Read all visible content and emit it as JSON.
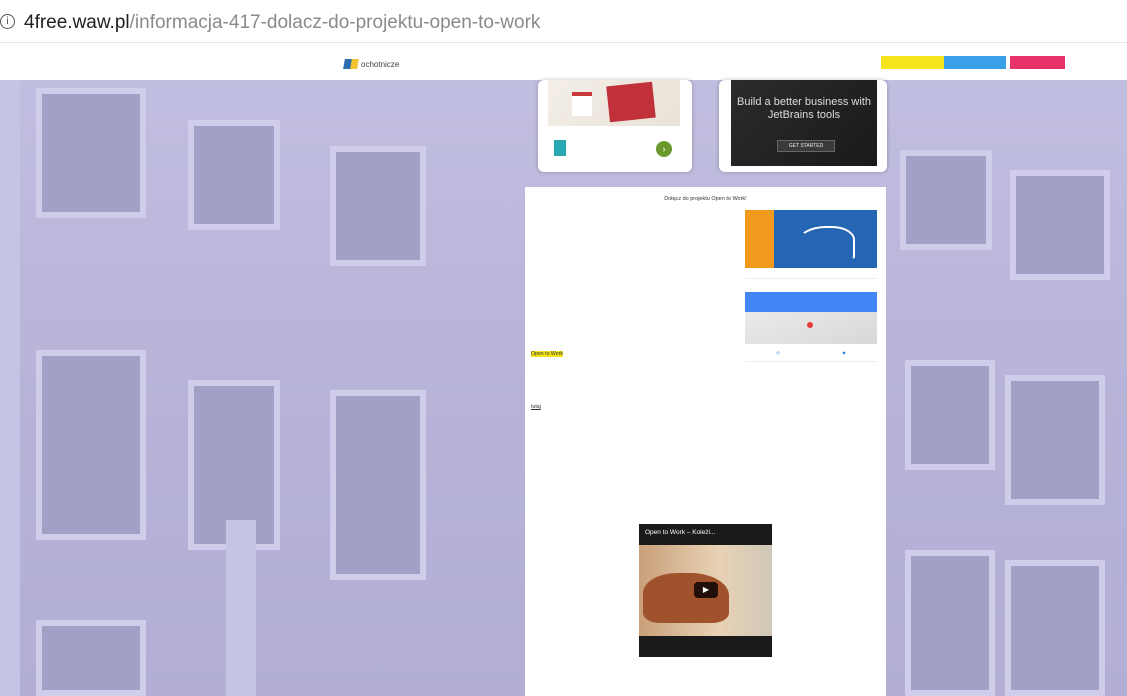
{
  "browser": {
    "url_host": "4free.waw.pl",
    "url_path": "/informacja-417-dolacz-do-projektu-open-to-work"
  },
  "header": {
    "logo_text": "ochotnicze"
  },
  "ads": {
    "jetbrains_headline": "Build a better business with JetBrains tools",
    "jetbrains_button": "GET STARTED"
  },
  "article": {
    "title": "Dołącz do projektu Open to Work!",
    "highlight_text": "Open to Work",
    "more_link": "tutaj",
    "video_title": "Open to Work – Koleżl..."
  },
  "colors": {
    "header_yellow": "#f5e41c",
    "header_blue": "#3aa0e8",
    "header_pink": "#e8336a",
    "highlight": "#f4e51b"
  }
}
